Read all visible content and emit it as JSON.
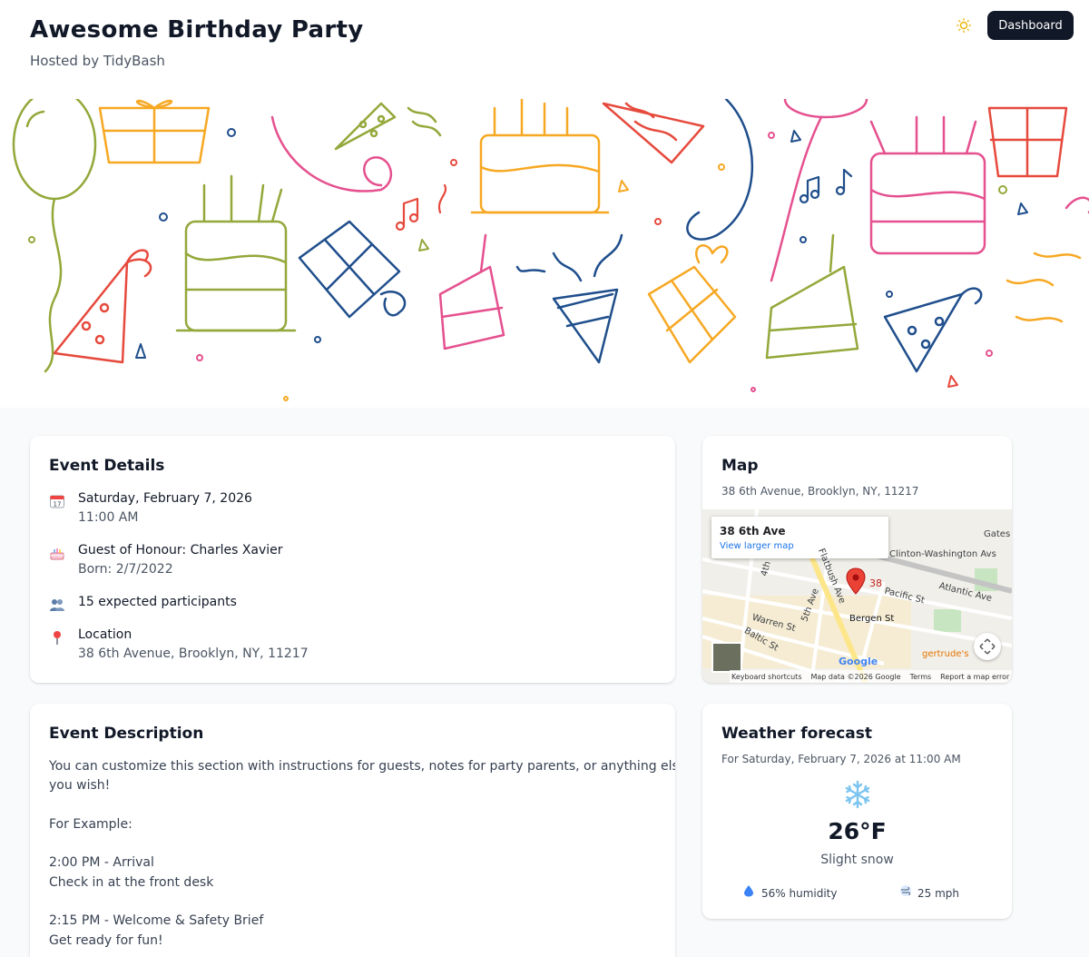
{
  "header": {
    "title": "Awesome Birthday Party",
    "subtitle": "Hosted by TidyBash",
    "theme_icon": "sun-icon",
    "dashboard_label": "Dashboard"
  },
  "event_details": {
    "heading": "Event Details",
    "date": "Saturday, February 7, 2026",
    "time": "11:00 AM",
    "honour": "Guest of Honour: Charles Xavier",
    "born": "Born: 2/7/2022",
    "participants": "15 expected participants",
    "location_label": "Location",
    "location": "38 6th Avenue, Brooklyn, NY, 11217",
    "icons": [
      "calendar-icon",
      "cake-icon",
      "people-icon",
      "pin-icon"
    ]
  },
  "map": {
    "heading": "Map",
    "address": "38 6th Avenue, Brooklyn, NY, 11217",
    "popup_title": "38 6th Ave",
    "popup_link": "View larger map",
    "pin_label": "38",
    "streets": [
      "Atlantic Ave",
      "Pacific St",
      "Bergen St",
      "Warren St",
      "Baltic St",
      "5th Ave",
      "Flatbush Ave",
      "4th",
      "Gates",
      "Clinton-Washington Avs",
      "gertrude's"
    ],
    "footer": [
      "Keyboard shortcuts",
      "Map data ©2026 Google",
      "Terms",
      "Report a map error"
    ],
    "google": "Google"
  },
  "description": {
    "heading": "Event Description",
    "lines": [
      "You can customize this section with instructions for guests, notes for party parents, or anything else",
      "you wish!",
      "For Example:",
      "2:00 PM - Arrival",
      "Check in at the front desk",
      "2:15 PM - Welcome & Safety Brief",
      "Get ready for fun!"
    ]
  },
  "weather": {
    "heading": "Weather forecast",
    "subtitle": "For Saturday, February 7, 2026 at 11:00 AM",
    "icon": "snowflake-icon",
    "temperature": "26°F",
    "condition": "Slight snow",
    "humidity": "56% humidity",
    "wind": "25 mph"
  },
  "colors": {
    "accent_dark": "#111827",
    "pink": "#e5508f",
    "orange": "#f7a823",
    "green": "#93a83a",
    "blue": "#1f4e8c",
    "red": "#e64a3d"
  }
}
